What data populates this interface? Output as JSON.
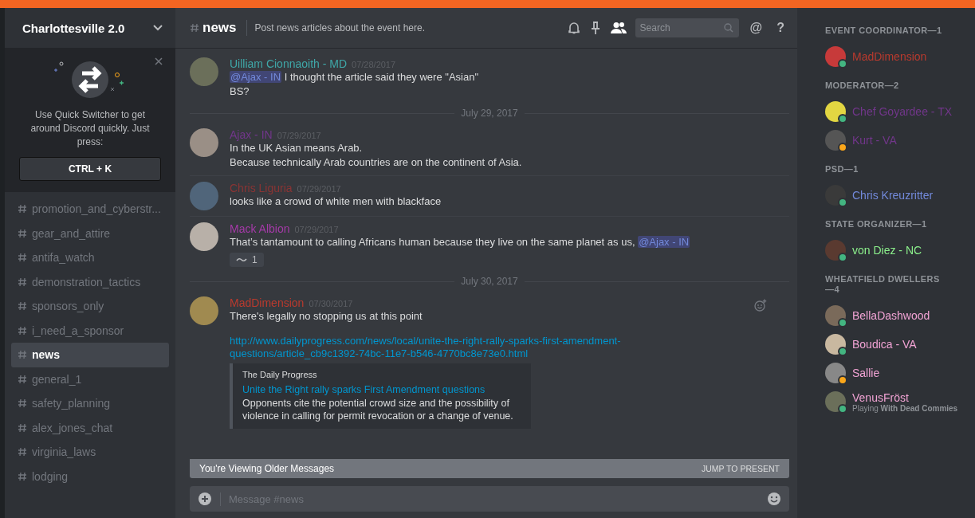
{
  "server": {
    "name": "Charlottesville 2.0"
  },
  "quick_switcher": {
    "text": "Use Quick Switcher to get around Discord quickly. Just press:",
    "shortcut": "CTRL + K"
  },
  "channels": [
    {
      "name": "promotion_and_cyberstr...",
      "selected": false
    },
    {
      "name": "gear_and_attire",
      "selected": false
    },
    {
      "name": "antifa_watch",
      "selected": false
    },
    {
      "name": "demonstration_tactics",
      "selected": false
    },
    {
      "name": "sponsors_only",
      "selected": false
    },
    {
      "name": "i_need_a_sponsor",
      "selected": false
    },
    {
      "name": "news",
      "selected": true
    },
    {
      "name": "general_1",
      "selected": false
    },
    {
      "name": "safety_planning",
      "selected": false
    },
    {
      "name": "alex_jones_chat",
      "selected": false
    },
    {
      "name": "virginia_laws",
      "selected": false
    },
    {
      "name": "lodging",
      "selected": false
    }
  ],
  "header": {
    "channel": "news",
    "topic": "Post news articles about the event here.",
    "search_placeholder": "Search",
    "mention_glyph": "@",
    "help_glyph": "?"
  },
  "messages": [
    {
      "kind": "message",
      "author": "Uilliam Cionnaoith - MD",
      "color": "#3fa7a8",
      "time": "07/28/2017",
      "lines": [
        [
          {
            "kind": "mention",
            "text": "@Ajax - IN"
          },
          {
            "kind": "text",
            "text": " I thought the article said they were \"Asian\""
          }
        ],
        [
          {
            "kind": "text",
            "text": "BS?"
          }
        ]
      ]
    },
    {
      "kind": "divider",
      "label": "July 29, 2017"
    },
    {
      "kind": "message",
      "author": "Ajax - IN",
      "color": "#71368a",
      "time": "07/29/2017",
      "lines": [
        [
          {
            "kind": "text",
            "text": "In the UK Asian means Arab."
          }
        ],
        [
          {
            "kind": "text",
            "text": "Because technically Arab countries are on the continent of Asia."
          }
        ]
      ]
    },
    {
      "kind": "message",
      "author": "Chris Liguria",
      "color": "#8a3434",
      "time": "07/29/2017",
      "lines": [
        [
          {
            "kind": "text",
            "text": "looks like a crowd of white men with blackface"
          }
        ]
      ]
    },
    {
      "kind": "message",
      "author": "Mack Albion",
      "color": "#a53aa8",
      "time": "07/29/2017",
      "lines": [
        [
          {
            "kind": "text",
            "text": "That’s tantamount to calling Africans human because they live on the same planet as us, "
          },
          {
            "kind": "mention",
            "text": "@Ajax - IN"
          }
        ]
      ],
      "reaction": {
        "count": "1"
      }
    },
    {
      "kind": "divider",
      "label": "July 30, 2017"
    },
    {
      "kind": "message",
      "author": "MadDimension",
      "color": "#b93a2e",
      "time": "07/30/2017",
      "lines": [
        [
          {
            "kind": "text",
            "text": "There's legally no stopping us at this point"
          }
        ]
      ],
      "link": "http://www.dailyprogress.com/news/local/unite-the-right-rally-sparks-first-amendment-questions/article_cb9c1392-74bc-11e7-b546-4770bc8e73e0.html",
      "embed": {
        "provider": "The Daily Progress",
        "title": "Unite the Right rally sparks First Amendment questions",
        "description": "Opponents cite the potential crowd size and the possibility of violence in calling for permit revocation or a change of venue."
      }
    }
  ],
  "older_banner": {
    "text": "You're Viewing Older Messages",
    "action": "JUMP TO PRESENT"
  },
  "composer": {
    "placeholder": "Message #news"
  },
  "member_groups": [
    {
      "title": "EVENT COORDINATOR—1",
      "members": [
        {
          "name": "MadDimension",
          "color": "#b93a2e",
          "idle": false
        }
      ]
    },
    {
      "title": "MODERATOR—2",
      "members": [
        {
          "name": "Chef Goyardee - TX",
          "color": "#71368a",
          "idle": false
        },
        {
          "name": "Kurt - VA",
          "color": "#71368a",
          "idle": true
        }
      ]
    },
    {
      "title": "PSD—1",
      "members": [
        {
          "name": "Chris Kreuzritter",
          "color": "#7289da",
          "idle": false
        }
      ]
    },
    {
      "title": "STATE ORGANIZER—1",
      "members": [
        {
          "name": "von Diez - NC",
          "color": "#8cf08c",
          "idle": false
        }
      ]
    },
    {
      "title": "WHEATFIELD DWELLERS—4",
      "members": [
        {
          "name": "BellaDashwood",
          "color": "#f1a3d4",
          "idle": false
        },
        {
          "name": "Boudica - VA",
          "color": "#f1a3d4",
          "idle": false
        },
        {
          "name": "Sallie",
          "color": "#f1a3d4",
          "idle": true
        },
        {
          "name": "VenusFröst",
          "color": "#f1a3d4",
          "idle": false,
          "activity": "Playing **With Dead Commies**"
        }
      ]
    }
  ]
}
